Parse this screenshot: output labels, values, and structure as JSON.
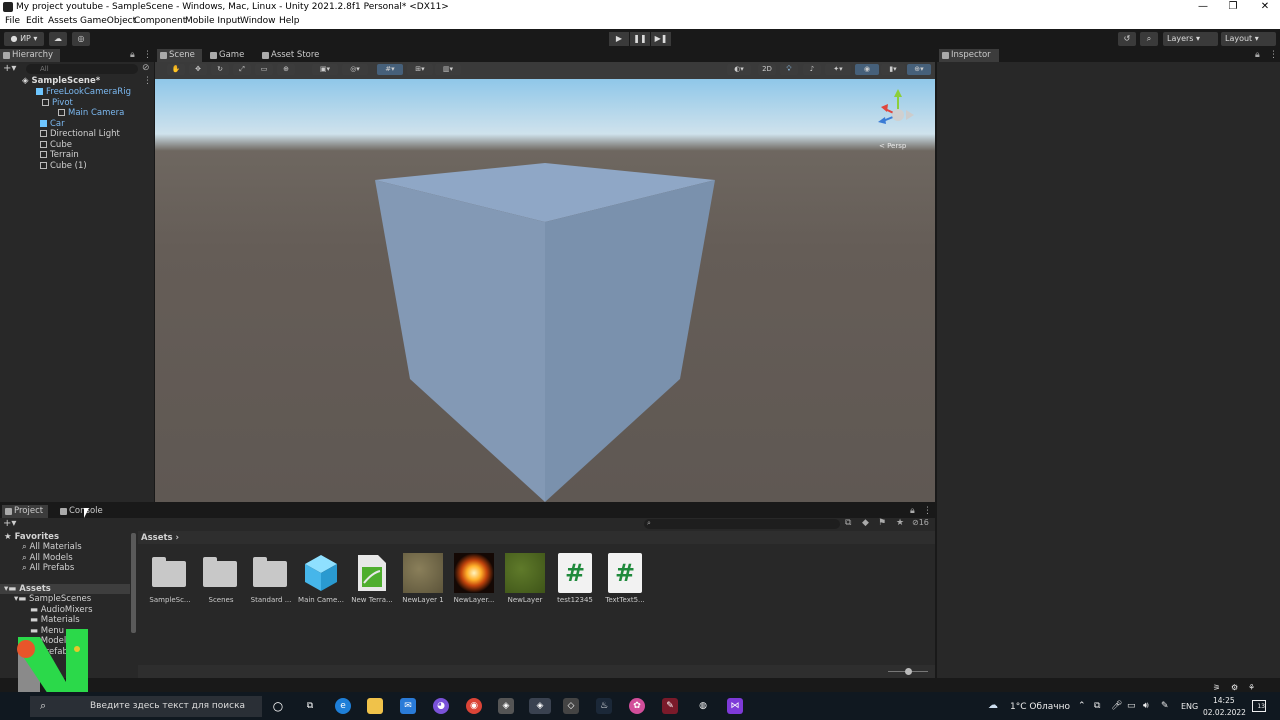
{
  "window": {
    "title": "My project youtube - SampleScene - Windows, Mac, Linux - Unity 2021.2.8f1 Personal* <DX11>",
    "minimize": "—",
    "maximize": "❐",
    "close": "✕"
  },
  "menu": [
    "File",
    "Edit",
    "Assets",
    "GameObject",
    "Component",
    "Mobile Input",
    "Window",
    "Help"
  ],
  "toolbar": {
    "account": "● ИР ▾",
    "cloud": "☁",
    "collab": "◎",
    "play": "▶",
    "pause": "❚❚",
    "step": "▶❚",
    "history": "↺",
    "search": "⌕",
    "layers": "Layers",
    "layout": "Layout"
  },
  "hierarchy": {
    "tab": "Hierarchy",
    "search_placeholder": "All",
    "scene": "SampleScene*",
    "items": [
      {
        "label": "FreeLookCameraRig",
        "color": "#7bb8f0"
      },
      {
        "label": "Pivot",
        "color": "#7bb8f0"
      },
      {
        "label": "Main Camera",
        "color": "#7bb8f0"
      },
      {
        "label": "Car",
        "color": "#7bb8f0"
      },
      {
        "label": "Directional Light",
        "color": "#cccccc"
      },
      {
        "label": "Cube",
        "color": "#cccccc"
      },
      {
        "label": "Terrain",
        "color": "#cccccc"
      },
      {
        "label": "Cube (1)",
        "color": "#cccccc"
      }
    ]
  },
  "scene_tabs": [
    "Scene",
    "Game",
    "Asset Store"
  ],
  "scene_toolbar": {
    "mode_2d": "2D",
    "persp": "< Persp"
  },
  "inspector": {
    "tab": "Inspector"
  },
  "project": {
    "tabs": [
      "Project",
      "Console"
    ],
    "breadcrumb": "Assets",
    "count": "16",
    "tree": {
      "favorites": "Favorites",
      "fav_items": [
        "All Materials",
        "All Models",
        "All Prefabs"
      ],
      "assets": "Assets",
      "asset_items": [
        "SampleScenes",
        "AudioMixers",
        "Materials",
        "Menu",
        "Models",
        "Prefabs"
      ]
    },
    "assets": [
      {
        "label": "SampleSc...",
        "kind": "folder"
      },
      {
        "label": "Scenes",
        "kind": "folder"
      },
      {
        "label": "Standard ...",
        "kind": "folder"
      },
      {
        "label": "Main Came...",
        "kind": "prefab"
      },
      {
        "label": "New Terra...",
        "kind": "terrain"
      },
      {
        "label": "NewLayer 1",
        "kind": "tex-dirt"
      },
      {
        "label": "NewLayer...",
        "kind": "tex-fire"
      },
      {
        "label": "NewLayer",
        "kind": "tex-grass"
      },
      {
        "label": "test12345",
        "kind": "script"
      },
      {
        "label": "TextText5...",
        "kind": "script"
      }
    ]
  },
  "taskbar": {
    "search_placeholder": "Введите здесь текст для поиска",
    "weather": "1°C Облачно",
    "lang": "ENG",
    "time": "14:25",
    "date": "02.02.2022",
    "notif": "13"
  }
}
